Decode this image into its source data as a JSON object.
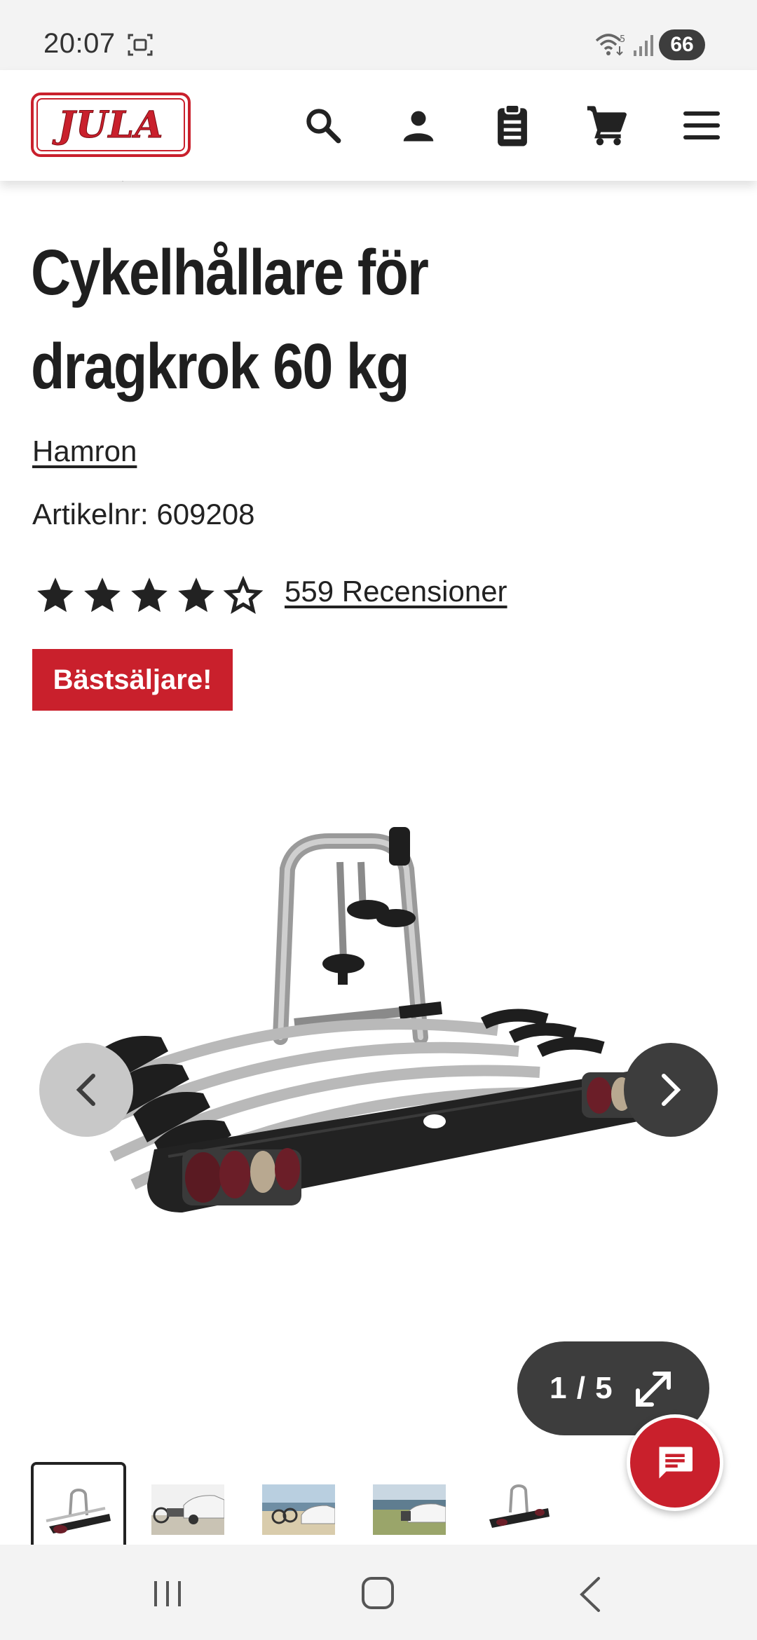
{
  "status_bar": {
    "time": "20:07",
    "battery": "66",
    "icons": [
      "screenshot-icon",
      "wifi-icon",
      "signal-icon",
      "battery-icon"
    ]
  },
  "header": {
    "logo_text": "JULA",
    "icons": [
      "search-icon",
      "account-icon",
      "clipboard-icon",
      "cart-icon",
      "menu-icon"
    ]
  },
  "product": {
    "title": "Cykelhållare för dragkrok 60 kg",
    "brand": "Hamron",
    "article_number": "Artikelnr: 609208",
    "rating": 4.5,
    "rating_max": 5,
    "reviews_label": "559 Recensioner",
    "badge": "Bästsäljare!"
  },
  "gallery": {
    "counter": "1 / 5",
    "current_index": 1,
    "total": 5,
    "thumbnails": [
      "bike-rack-product",
      "bike-rack-on-car",
      "bike-rack-beach",
      "bike-rack-lake",
      "bike-rack-folded"
    ]
  },
  "colors": {
    "brand_red": "#c9202c",
    "dark": "#3d3d3d",
    "light_gray": "#c8c8c8"
  }
}
